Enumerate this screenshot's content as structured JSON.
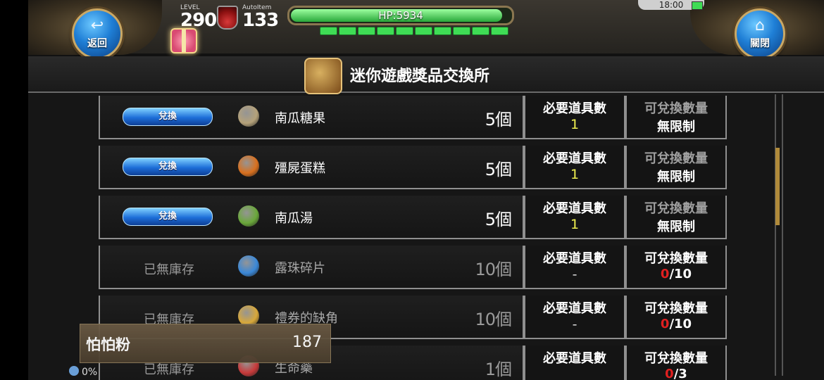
{
  "hud": {
    "back_label": "返回",
    "close_label": "關閉",
    "level_caption": "LEVEL",
    "level_value": "290",
    "autoitem_caption": "AutoItem",
    "autoitem_value": "133",
    "hp_text": "HP:5934",
    "hp_fraction": 0.98,
    "energy_segments": 10,
    "clock": "18:00"
  },
  "page": {
    "title": "迷你遊戲獎品交換所"
  },
  "rows": [
    {
      "action": "兌換",
      "in_stock": true,
      "item": "南瓜糖果",
      "cost": "5個",
      "req_header": "必要道具數",
      "req_value": "1",
      "avail_header": "可兌換數量",
      "avail_value": "無限制",
      "icon_color": "#b5a27a"
    },
    {
      "action": "兌換",
      "in_stock": true,
      "item": "殭屍蛋糕",
      "cost": "5個",
      "req_header": "必要道具數",
      "req_value": "1",
      "avail_header": "可兌換數量",
      "avail_value": "無限制",
      "icon_color": "#d9701e"
    },
    {
      "action": "兌換",
      "in_stock": true,
      "item": "南瓜湯",
      "cost": "5個",
      "req_header": "必要道具數",
      "req_value": "1",
      "avail_header": "可兌換數量",
      "avail_value": "無限制",
      "icon_color": "#6aa83a"
    },
    {
      "action": "已無庫存",
      "in_stock": false,
      "item": "露珠碎片",
      "cost": "10個",
      "req_header": "必要道具數",
      "req_value": "-",
      "avail_header": "可兌換數量",
      "avail_used": "0",
      "avail_total": "/10",
      "icon_color": "#3a88d8"
    },
    {
      "action": "已無庫存",
      "in_stock": false,
      "item": "禮券的缺角",
      "cost": "10個",
      "req_header": "必要道具數",
      "req_value": "-",
      "avail_header": "可兌換數量",
      "avail_used": "0",
      "avail_total": "/10",
      "icon_color": "#d8a83a"
    },
    {
      "action": "已無庫存",
      "in_stock": false,
      "item": "生命藥",
      "cost": "1個",
      "req_header": "必要道具數",
      "req_value": "",
      "avail_header": "可兌換數量",
      "avail_used": "0",
      "avail_total": "/3",
      "icon_color": "#c83a3a"
    }
  ],
  "currency": {
    "name": "怕怕粉",
    "amount": "187"
  },
  "footer": {
    "percent": "0%"
  }
}
